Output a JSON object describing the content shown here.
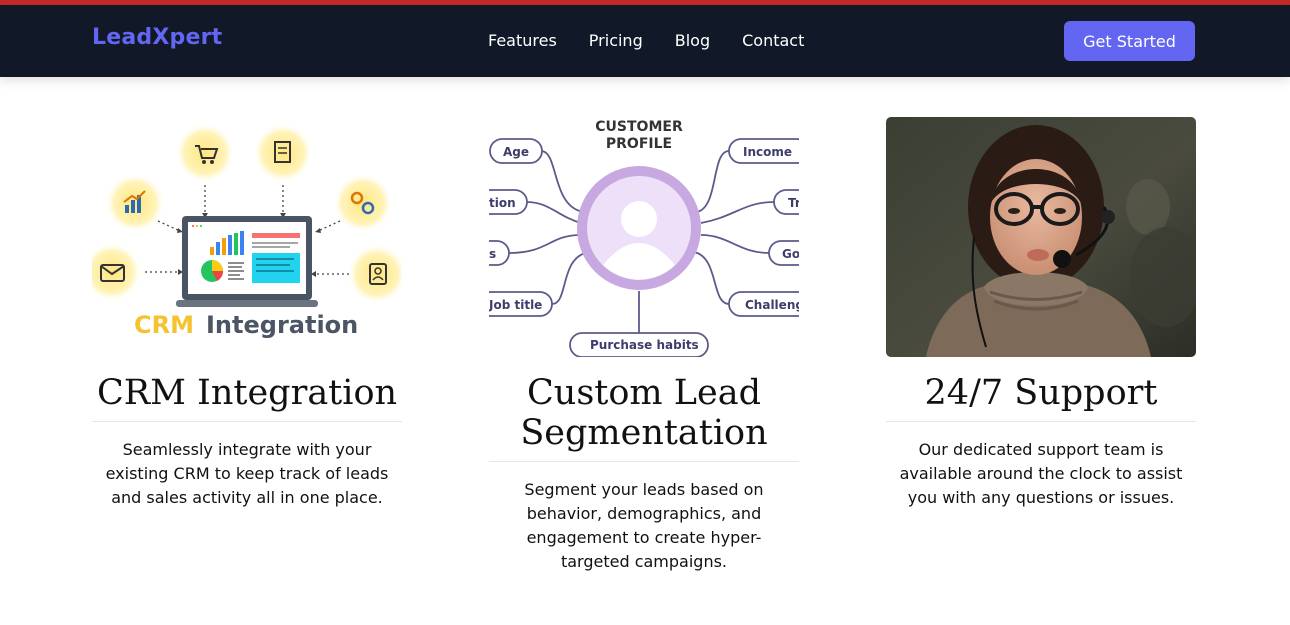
{
  "brand": {
    "name": "LeadXpert"
  },
  "nav": {
    "items": [
      "Features",
      "Pricing",
      "Blog",
      "Contact"
    ]
  },
  "cta": {
    "label": "Get Started"
  },
  "features": [
    {
      "title": "CRM Integration",
      "description": "Seamlessly integrate with your existing CRM to keep track of leads and sales activity all in one place.",
      "image_text": {
        "word1": "CRM",
        "word2": "Integration"
      }
    },
    {
      "title": "Custom Lead Segmentation",
      "description": "Segment your leads based on behavior, demographics, and engagement to create hyper-targeted campaigns.",
      "image_text": {
        "heading_line1": "CUSTOMER",
        "heading_line2": "PROFILE",
        "labels": [
          "Age",
          "tion",
          "s",
          "Job title",
          "Purchase habits",
          "Income",
          "Tr",
          "Go",
          "Challeng"
        ]
      }
    },
    {
      "title": "24/7 Support",
      "description": "Our dedicated support team is available around the clock to assist you with any questions or issues."
    }
  ],
  "colors": {
    "brand": "#6366f1",
    "nav_bg": "#111827",
    "top_border": "#c62828",
    "crm_yellow": "#f4c430",
    "profile_purple": "#c8a8e0"
  }
}
